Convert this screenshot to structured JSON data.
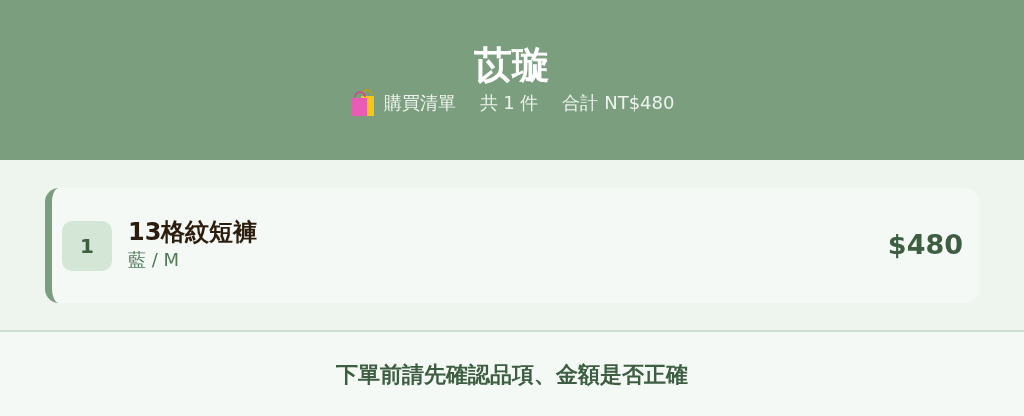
{
  "header": {
    "title": "苡璇",
    "list_label": "購買清單",
    "count": "共 1 件",
    "total": "合計 NT$480"
  },
  "items": [
    {
      "number": "1",
      "name": "13格紋短褲",
      "variant": "藍 / M",
      "price": "$480"
    }
  ],
  "footer": {
    "note": "下單前請先確認品項、金額是否正確"
  }
}
